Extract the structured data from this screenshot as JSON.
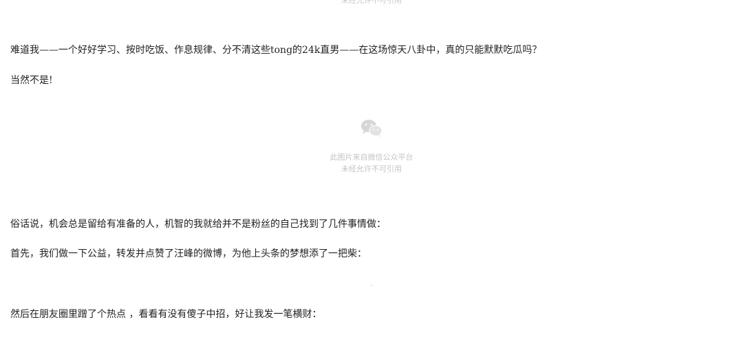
{
  "top_watermark": "未经允许不可引用",
  "paragraphs": {
    "p1": "难道我——一个好好学习、按时吃饭、作息规律、分不清这些tong的24k直男——在这场惊天八卦中，真的只能默默吃瓜吗？",
    "p2": "当然不是!",
    "p3": "俗话说，机会总是留给有准备的人，机智的我就给并不是粉丝的自己找到了几件事情做：",
    "p4": "首先，我们做一下公益，转发并点赞了汪峰的微博，为他上头条的梦想添了一把柴：",
    "p5": "然后在朋友圈里蹭了个热点 ，看看有没有傻子中招，好让我发一笔横财："
  },
  "image_placeholder": {
    "icon": "wechat-icon",
    "line1": "此图片来自微信公众平台",
    "line2": "未经允许不可引用"
  },
  "colors": {
    "text": "#222222",
    "watermark": "#c4c4c4",
    "background": "#ffffff"
  }
}
